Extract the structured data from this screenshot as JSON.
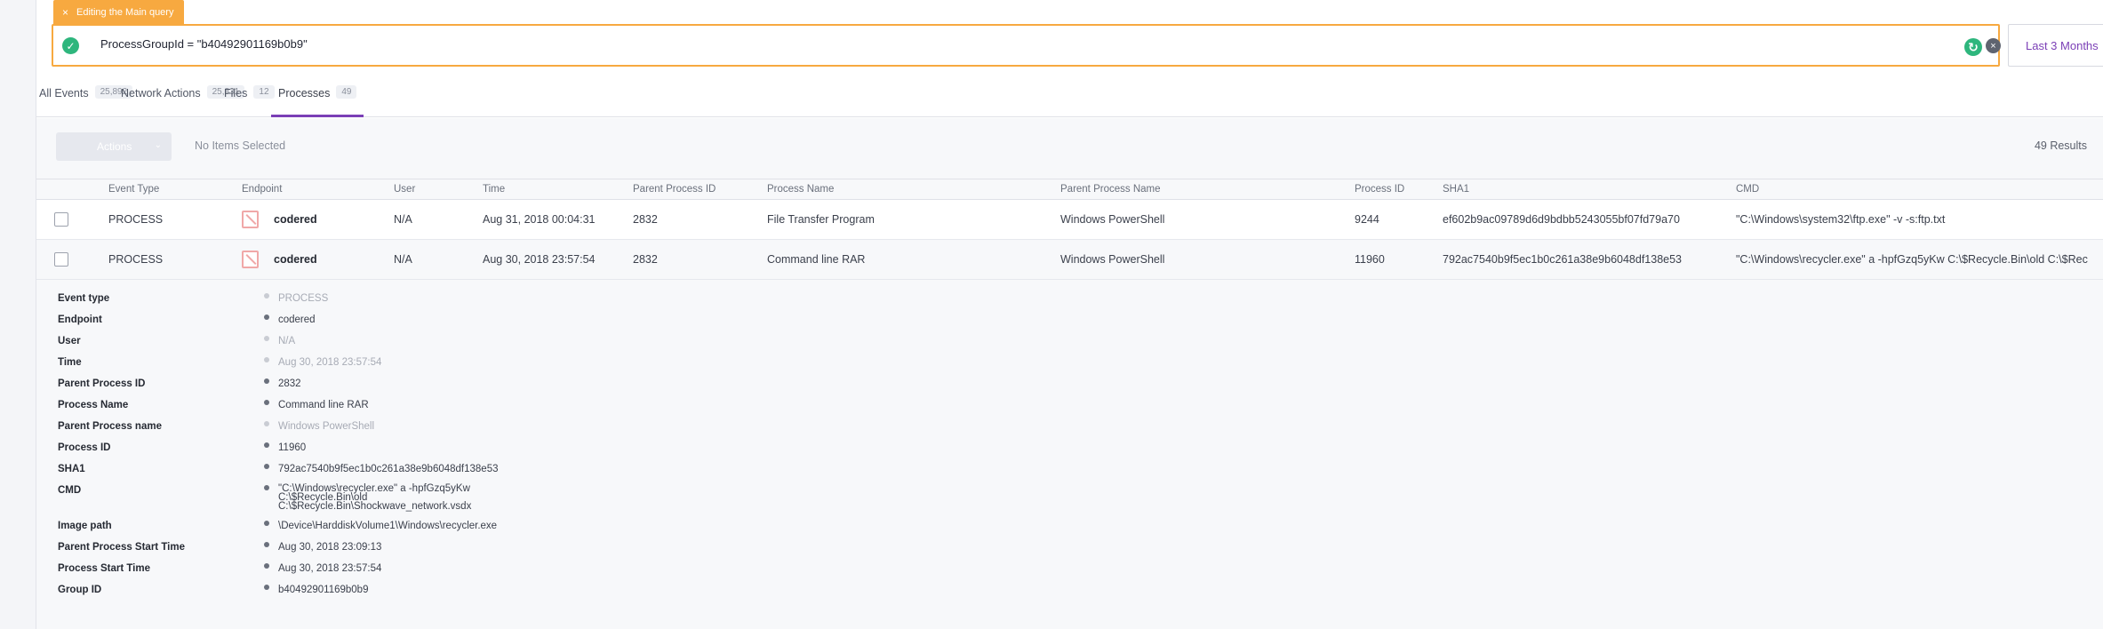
{
  "editing_tag": {
    "close": "×",
    "label": "Editing the Main query"
  },
  "query": {
    "text": "ProcessGroupId = \"b40492901169b0b9\"",
    "ok_icon": "✓",
    "refresh_icon": "↻",
    "clear_icon": "×"
  },
  "date_range": "Last 3 Months",
  "tabs": [
    {
      "label": "All Events",
      "count": "25,892"
    },
    {
      "label": "Network Actions",
      "count": "25,831"
    },
    {
      "label": "Files",
      "count": "12"
    },
    {
      "label": "Processes",
      "count": "49"
    }
  ],
  "toolbar": {
    "actions_label": "Actions",
    "actions_caret": "⌄",
    "selection_status": "No Items Selected",
    "results": "49 Results"
  },
  "columns": [
    "Event Type",
    "Endpoint",
    "User",
    "Time",
    "Parent Process ID",
    "Process Name",
    "Parent Process Name",
    "Process ID",
    "SHA1",
    "CMD"
  ],
  "rows": [
    {
      "event_type": "PROCESS",
      "endpoint": "codered",
      "user": "N/A",
      "time": "Aug 31, 2018 00:04:31",
      "parent_pid": "2832",
      "process_name": "File Transfer Program",
      "parent_process_name": "Windows PowerShell",
      "pid": "9244",
      "sha1": "ef602b9ac09789d6d9bdbb5243055bf07fd79a70",
      "cmd": "\"C:\\Windows\\system32\\ftp.exe\" -v -s:ftp.txt"
    },
    {
      "event_type": "PROCESS",
      "endpoint": "codered",
      "user": "N/A",
      "time": "Aug 30, 2018 23:57:54",
      "parent_pid": "2832",
      "process_name": "Command line RAR",
      "parent_process_name": "Windows PowerShell",
      "pid": "11960",
      "sha1": "792ac7540b9f5ec1b0c261a38e9b6048df138e53",
      "cmd": "\"C:\\Windows\\recycler.exe\" a -hpfGzq5yKw C:\\$Recycle.Bin\\old C:\\$Rec"
    }
  ],
  "detail": [
    {
      "label": "Event type",
      "value": "PROCESS",
      "muted": true
    },
    {
      "label": "Endpoint",
      "value": "codered",
      "muted": false
    },
    {
      "label": "User",
      "value": "N/A",
      "muted": true
    },
    {
      "label": "Time",
      "value": "Aug 30, 2018 23:57:54",
      "muted": true
    },
    {
      "label": "Parent Process ID",
      "value": "2832",
      "muted": false
    },
    {
      "label": "Process Name",
      "value": "Command line RAR",
      "muted": false
    },
    {
      "label": "Parent Process name",
      "value": "Windows PowerShell",
      "muted": true
    },
    {
      "label": "Process ID",
      "value": "11960",
      "muted": false
    },
    {
      "label": "SHA1",
      "value": "792ac7540b9f5ec1b0c261a38e9b6048df138e53",
      "muted": false
    },
    {
      "label": "CMD",
      "value_lines": [
        "\"C:\\Windows\\recycler.exe\" a -hpfGzq5yKw",
        "C:\\$Recycle.Bin\\old",
        "C:\\$Recycle.Bin\\Shockwave_network.vsdx"
      ],
      "muted": false
    },
    {
      "label": "Image path",
      "value": "\\Device\\HarddiskVolume1\\Windows\\recycler.exe",
      "muted": false
    },
    {
      "label": "Parent Process Start Time",
      "value": "Aug 30, 2018 23:09:13",
      "muted": false
    },
    {
      "label": "Process Start Time",
      "value": "Aug 30, 2018 23:57:54",
      "muted": false
    },
    {
      "label": "Group ID",
      "value": "b40492901169b0b9",
      "muted": false
    }
  ],
  "colors": {
    "accent_purple": "#7b3fb6",
    "warning_orange": "#f7a940",
    "success_green": "#2eb67d"
  }
}
